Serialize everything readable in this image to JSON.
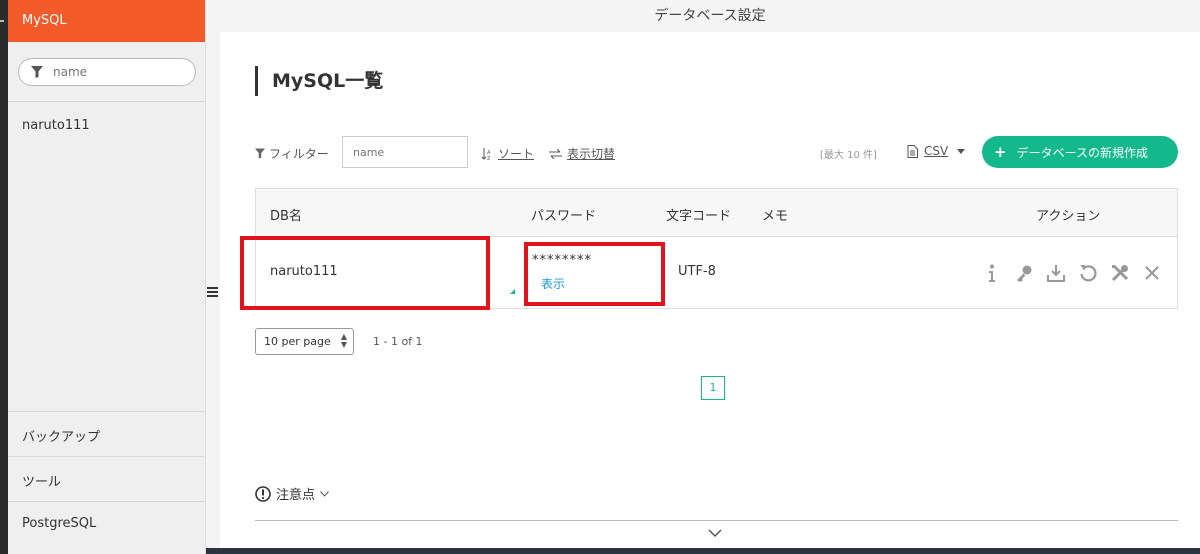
{
  "sidebar": {
    "active": "MySQL",
    "search_placeholder": "name",
    "db_item": "naruto111",
    "bottom_items": [
      "バックアップ",
      "ツール",
      "PostgreSQL"
    ]
  },
  "topbar": {
    "title": "データベース設定"
  },
  "page": {
    "title": "MySQL一覧"
  },
  "toolbar": {
    "filter_label": "フィルター",
    "filter_placeholder": "name",
    "sort_label": "ソート",
    "toggle_label": "表示切替",
    "max_info": "[最大 10 件]",
    "csv_label": "CSV",
    "new_button": "データベースの新規作成"
  },
  "table": {
    "headers": {
      "db_name": "DB名",
      "password": "パスワード",
      "charset": "文字コード",
      "memo": "メモ",
      "actions": "アクション"
    },
    "rows": [
      {
        "db_name": "naruto111",
        "password": "********",
        "show_link": "表示",
        "charset": "UTF-8",
        "memo": ""
      }
    ],
    "action_icons": [
      "info-icon",
      "key-icon",
      "download-icon",
      "restore-icon",
      "tools-icon",
      "close-icon"
    ]
  },
  "pagination": {
    "per_page": "10 per page",
    "range": "1 - 1 of 1",
    "current_page": "1"
  },
  "notes": {
    "label": "注意点"
  },
  "colors": {
    "accent_orange": "#f25a29",
    "accent_green": "#13b98a",
    "highlight_red": "#e1141e"
  }
}
